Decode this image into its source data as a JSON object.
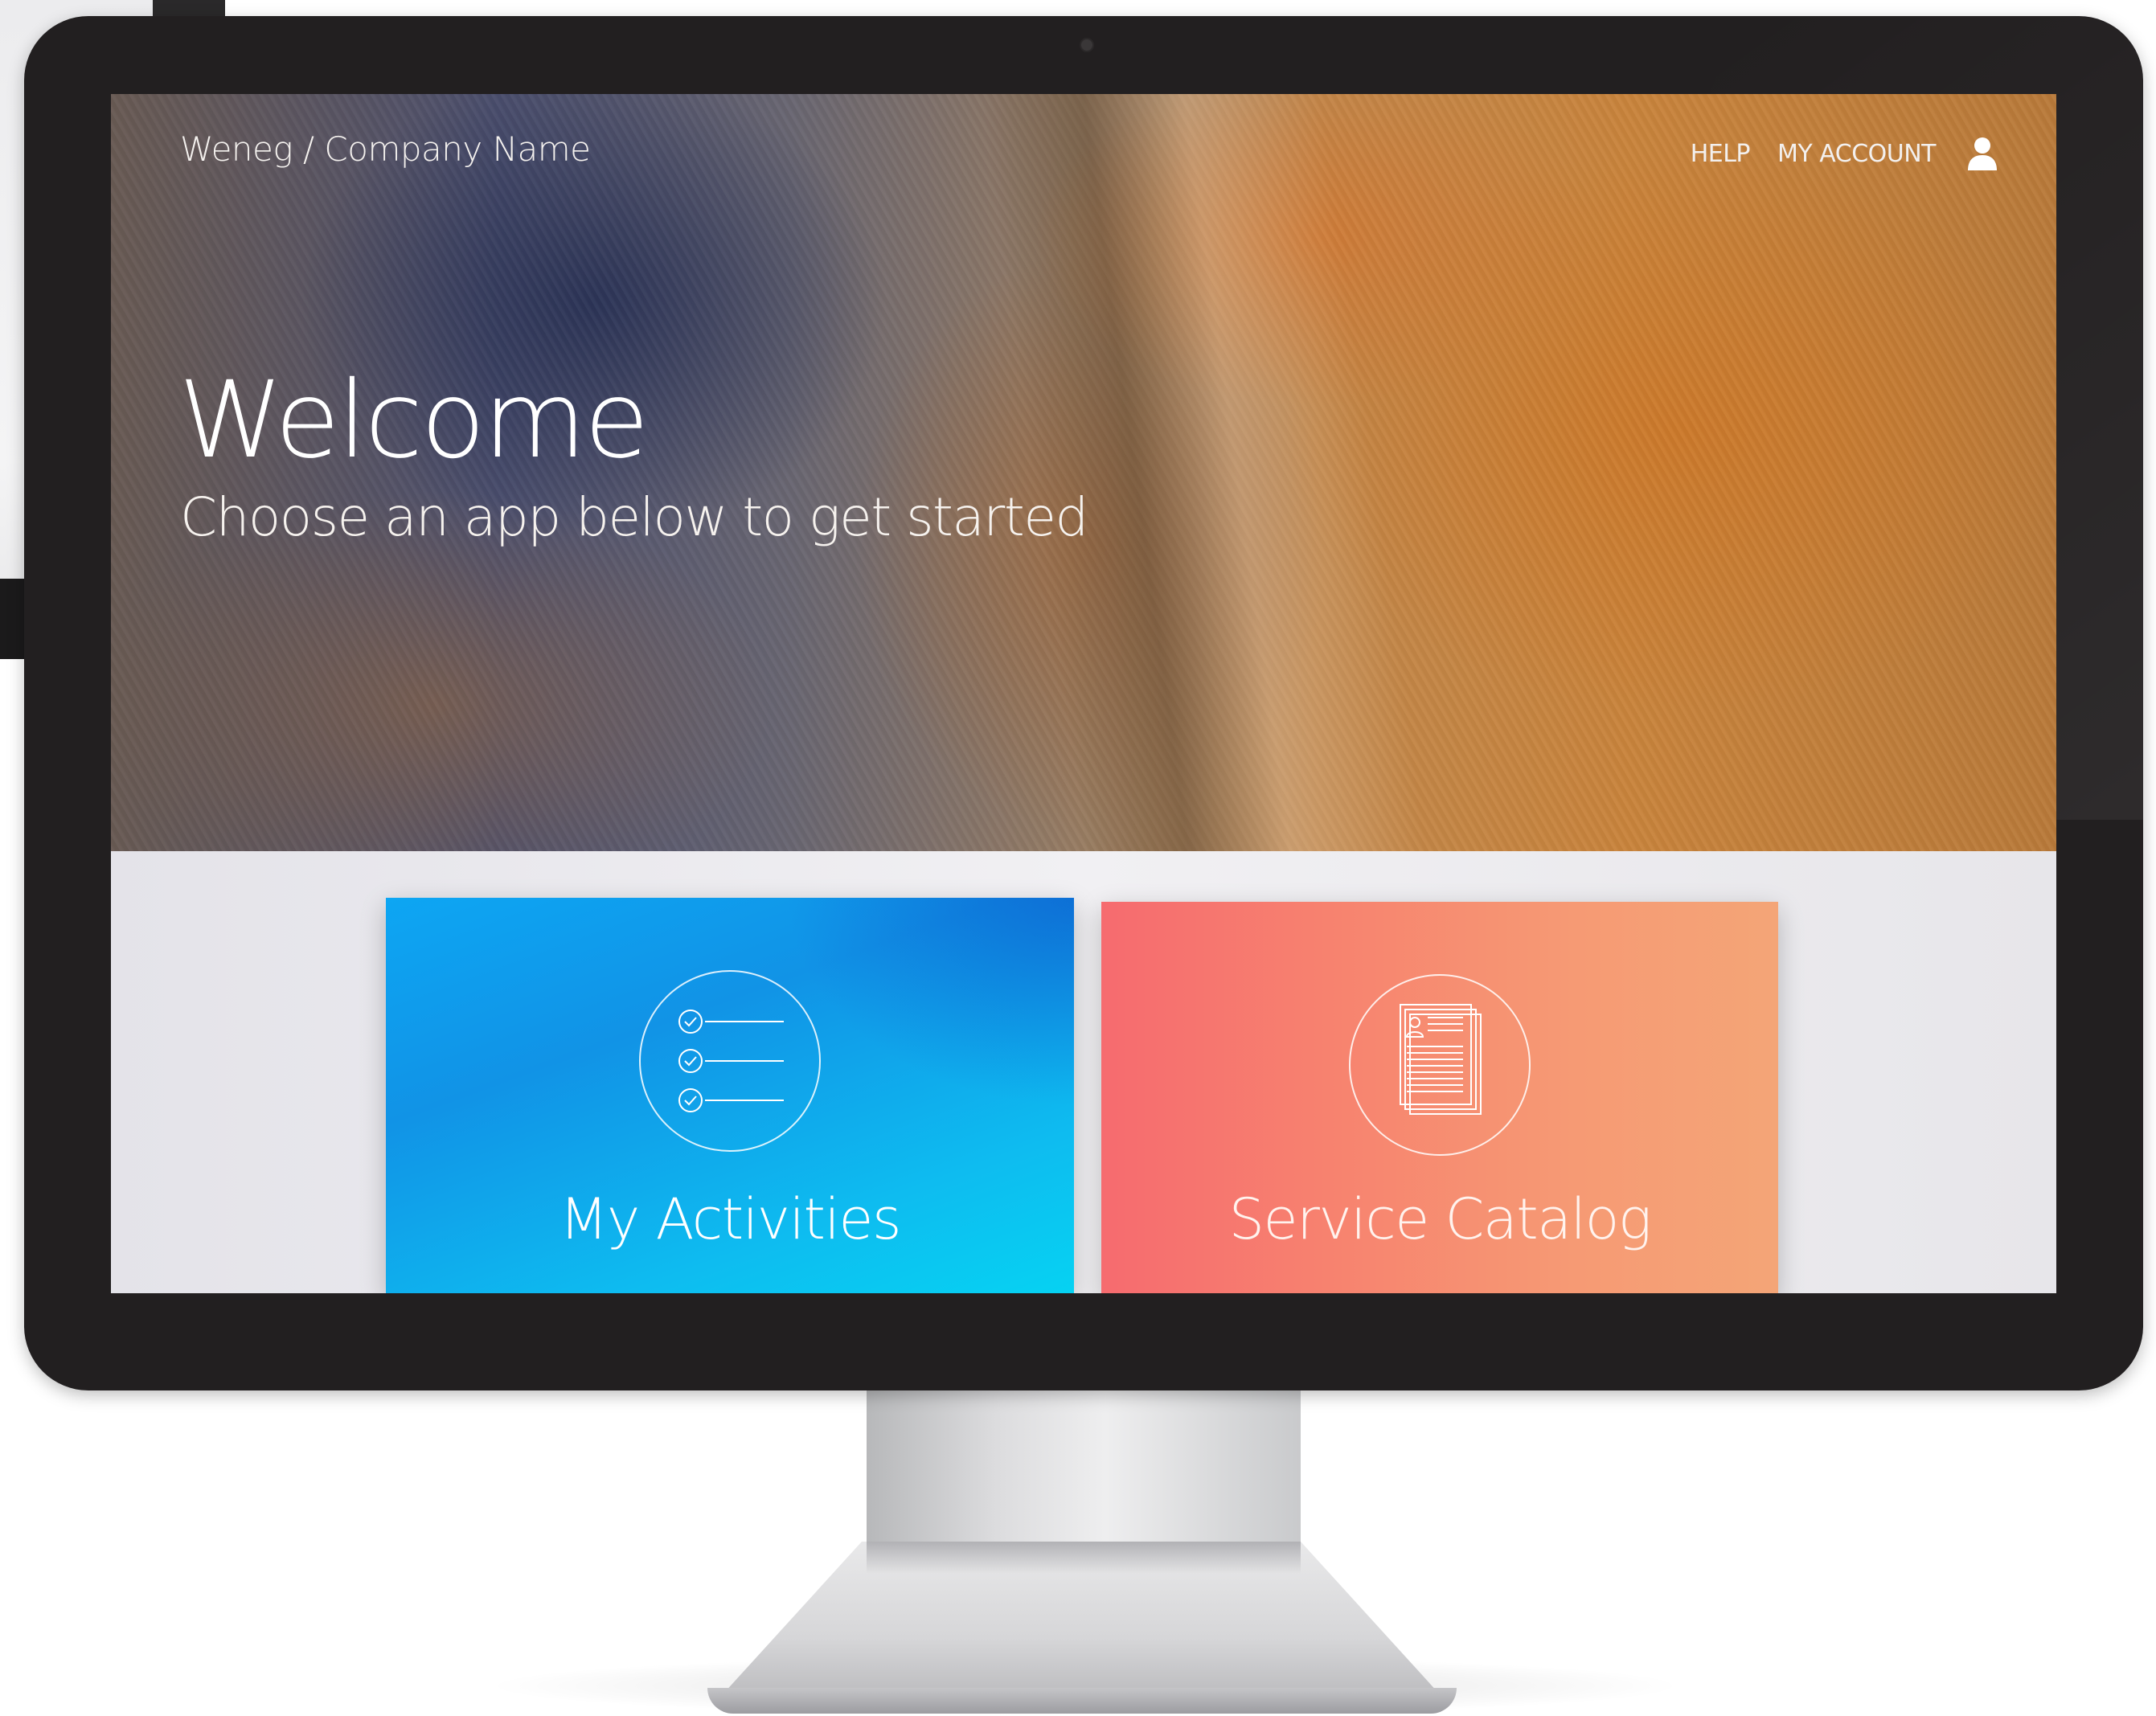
{
  "header": {
    "brand": "Weneg / Company Name",
    "nav": {
      "help": "HELP",
      "my_account": "MY ACCOUNT"
    },
    "account_icon": "user-icon"
  },
  "hero": {
    "title": "Welcome",
    "subtitle": "Choose an app below to get started"
  },
  "apps": [
    {
      "label": "My Activities",
      "icon": "checklist-icon",
      "color": "#0ea5f2"
    },
    {
      "label": "Service Catalog",
      "icon": "document-icon",
      "color": "#f6786f"
    }
  ]
}
